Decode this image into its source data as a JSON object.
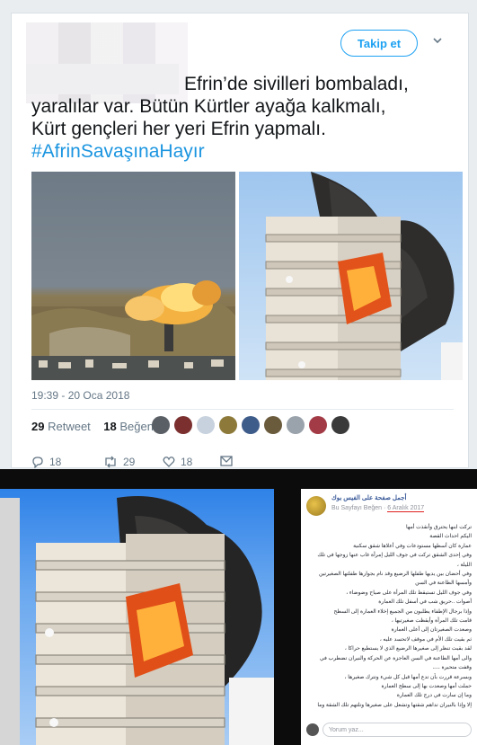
{
  "tweet": {
    "follow_label": "Takip et",
    "text_line1": "Efrin’de sivilleri bombaladı,",
    "text_line2": "yaralılar var. Bütün Kürtler ayağa kalkmalı,",
    "text_line3": "Kürt gençleri her yeri Efrin yapmalı.",
    "hashtag": "#AfrinSavaşınaHayır",
    "timestamp": "19:39 - 20 Oca 2018",
    "retweet_count": "29",
    "retweet_label": "Retweet",
    "like_count": "18",
    "like_label": "Beğeni",
    "actions": {
      "reply_count": "18",
      "retweet_count": "29",
      "like_count": "18"
    }
  },
  "facebook": {
    "page_name": "أجمل صفحة على الفيس بوك",
    "like_page_label": "Bu Sayfayı Beğen",
    "date": "6 Aralık 2017",
    "body_lines": [
      "تركت ابنها يحترق وأنقذت أمها",
      "اليكم احداث القصة",
      "عمارة كان أسطها مستودعات وفي أعلاها شقق سكنية",
      "وفي إحدى الشقق تركت في جوف الليل إمرأة غاب عنها زوجها في تلك",
      "الليلة ،",
      "وفي أحضان بين يديها طفلها الرضيع وقد نام بجوارها طفلتها الصغيرتين",
      "وأمسها الطاعنة في السن",
      "وفي جوف الليل تستيقظ تلك المرأة على صياح وضوضاء ،",
      "أصوات ..حريق شب في أسفل تلك العمارة",
      "وإذا برجال الإطفاء يطلبون من الجميع إخلاء العمارة إلى السطح",
      "قامت تلك المرأة وأيقظت صغيرتيها ،",
      "وصعدت الصغيرتان إلى أعلى العمارة",
      "ثم بقيت تلك الأم في موقف لاتحسد عليه ،",
      "لقد بقيت تنظر إلى صغيرها الرضيع الذي لا يستطيع حراكا ،",
      "والى أمها الطاعنة في السن العاجزة عن الحركة والنيران تضطرب في",
      "وقفت متحيرة .....",
      "وبسرعة قررت بأن تدع أمها قبل كل شيء وتترك صغيرها ،",
      "حملت أمها وصعدت بها إلى سطح العمارة",
      "وما إن سارت في درج تلك العمارة",
      "إلا  وإذا بالنيران تداهم شقتها وتشعل على صغيرها وتلتهم تلك الشقة وما"
    ],
    "comment_placeholder": "Yorum yaz..."
  }
}
